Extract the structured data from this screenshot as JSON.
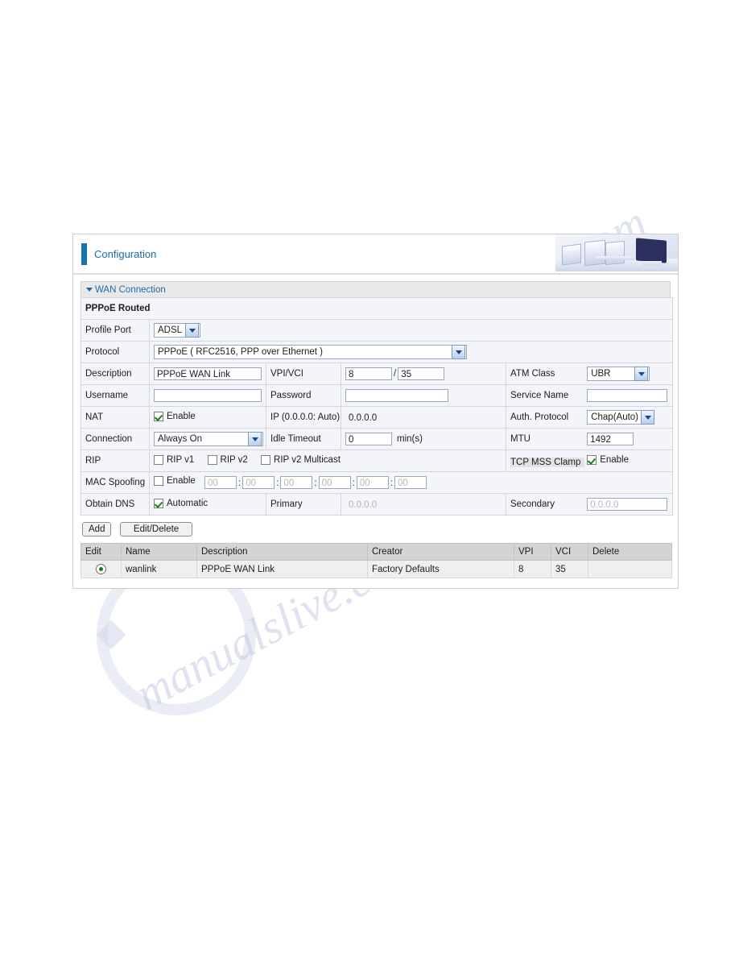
{
  "watermark": {
    "line1": "manualslive.com",
    "line2": "manualslive.com"
  },
  "header": {
    "title": "Configuration",
    "art_name": "office-monitors-image"
  },
  "section": {
    "title": "WAN Connection",
    "caret": "caret-down-icon"
  },
  "form": {
    "subtitle": "PPPoE Routed",
    "rows": {
      "profile_port": {
        "label": "Profile Port",
        "value": "ADSL"
      },
      "protocol": {
        "label": "Protocol",
        "value": "PPPoE ( RFC2516, PPP over Ethernet )"
      },
      "description": {
        "label": "Description",
        "value": "PPPoE WAN Link"
      },
      "vpi_vci": {
        "label": "VPI/VCI",
        "vpi": "8",
        "vci": "35",
        "separator": "/"
      },
      "atm_class": {
        "label": "ATM Class",
        "value": "UBR"
      },
      "username": {
        "label": "Username",
        "value": ""
      },
      "password": {
        "label": "Password",
        "value": ""
      },
      "service_name": {
        "label": "Service Name",
        "value": ""
      },
      "nat": {
        "label": "NAT",
        "checkbox_label": "Enable",
        "checked": true
      },
      "ip": {
        "label": "IP (0.0.0.0: Auto)",
        "value": "0.0.0.0"
      },
      "auth_protocol": {
        "label": "Auth. Protocol",
        "value": "Chap(Auto)"
      },
      "connection": {
        "label": "Connection",
        "value": "Always On"
      },
      "idle_timeout": {
        "label": "Idle Timeout",
        "value": "0",
        "unit": "min(s)"
      },
      "mtu": {
        "label": "MTU",
        "value": "1492"
      },
      "rip": {
        "label": "RIP",
        "options": [
          {
            "label": "RIP v1",
            "checked": false
          },
          {
            "label": "RIP v2",
            "checked": false
          },
          {
            "label": "RIP v2 Multicast",
            "checked": false
          }
        ]
      },
      "tcp_mss_clamp": {
        "label": "TCP MSS Clamp",
        "checkbox_label": "Enable",
        "checked": true
      },
      "mac_spoofing": {
        "label": "MAC Spoofing",
        "checkbox_label": "Enable",
        "checked": false,
        "octets": [
          "00",
          "00",
          "00",
          "00",
          "00",
          "00"
        ],
        "separator": ":"
      },
      "obtain_dns": {
        "label": "Obtain DNS",
        "checkbox_label": "Automatic",
        "checked": true,
        "primary_label": "Primary",
        "primary_value": "0.0.0.0",
        "secondary_label": "Secondary",
        "secondary_value": "0.0.0.0"
      }
    }
  },
  "buttons": {
    "add": "Add",
    "edit_delete": "Edit/Delete"
  },
  "results": {
    "columns": [
      "Edit",
      "Name",
      "Description",
      "Creator",
      "VPI",
      "VCI",
      "Delete"
    ],
    "rows": [
      {
        "edit_selected": true,
        "name": "wanlink",
        "description": "PPPoE WAN Link",
        "creator": "Factory Defaults",
        "vpi": "8",
        "vci": "35",
        "delete": ""
      }
    ]
  },
  "colors": {
    "accent": "#1b6ba8",
    "tab": "#1b72b0",
    "label_bg": "#e3e3e3",
    "field_bg": "#f3f5fa"
  }
}
